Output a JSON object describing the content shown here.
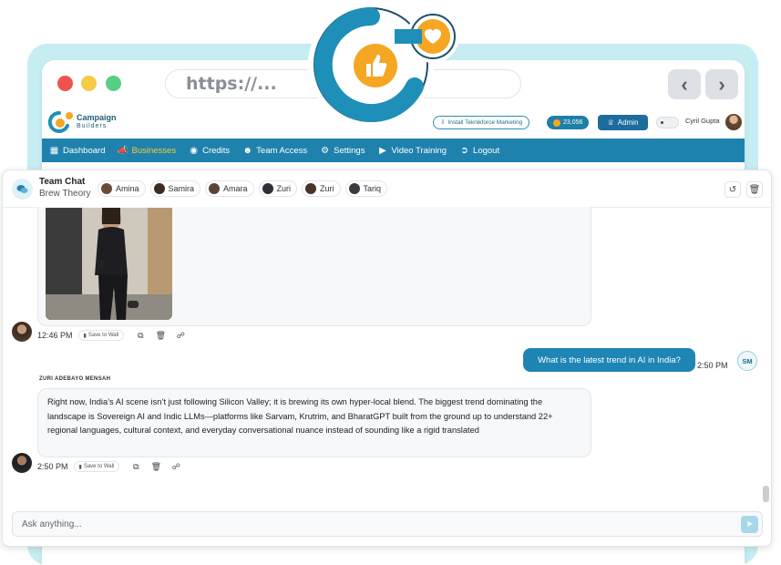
{
  "browser": {
    "url_placeholder": "https://...",
    "back_icon": "chevron-left-icon",
    "forward_icon": "chevron-right-icon"
  },
  "app": {
    "logo_line1": "Campaign",
    "logo_line2": "Builders",
    "install_label": "Install Teknikforce Marketing",
    "credits_value": "23,056",
    "admin_label": "Admin",
    "user_name": "Cyril Gupta"
  },
  "menu": [
    {
      "label": "Dashboard",
      "icon": "grid-icon",
      "active": false
    },
    {
      "label": "Businesses",
      "icon": "megaphone-icon",
      "active": true
    },
    {
      "label": "Credits",
      "icon": "coins-icon",
      "active": false
    },
    {
      "label": "Team Access",
      "icon": "users-icon",
      "active": false
    },
    {
      "label": "Settings",
      "icon": "gear-icon",
      "active": false
    },
    {
      "label": "Video Training",
      "icon": "video-icon",
      "active": false
    },
    {
      "label": "Logout",
      "icon": "logout-icon",
      "active": false
    }
  ],
  "chat": {
    "title": "Team Chat",
    "subtitle": "Brew Theory",
    "members": [
      "Amina",
      "Samira",
      "Amara",
      "Zuri",
      "Zuri",
      "Tariq"
    ],
    "messages": [
      {
        "type": "image",
        "time": "12:46 PM",
        "save_label": "Save to Wall"
      },
      {
        "type": "user",
        "text": "What is the latest trend in AI in India?",
        "time": "2:50 PM",
        "initials": "SM"
      },
      {
        "type": "ai",
        "sender": "ZURI ADEBAYO MENSAH",
        "text": "Right now, India’s AI scene isn’t just following Silicon Valley; it is brewing its own hyper-local blend. The biggest trend dominating the landscape is Sovereign AI and Indic LLMs—platforms like Sarvam, Krutrim, and BharatGPT built from the ground up to understand 22+ regional languages, cultural context, and everyday conversational nuance instead of sounding like a rigid translated",
        "time": "2:50 PM",
        "save_label": "Save to Wall"
      }
    ],
    "input_placeholder": "Ask anything..."
  },
  "colors": {
    "brand_blue": "#1e82ad",
    "accent_orange": "#f5a623",
    "active_menu": "#f7c93a",
    "frame_bg": "#c6eef2"
  }
}
